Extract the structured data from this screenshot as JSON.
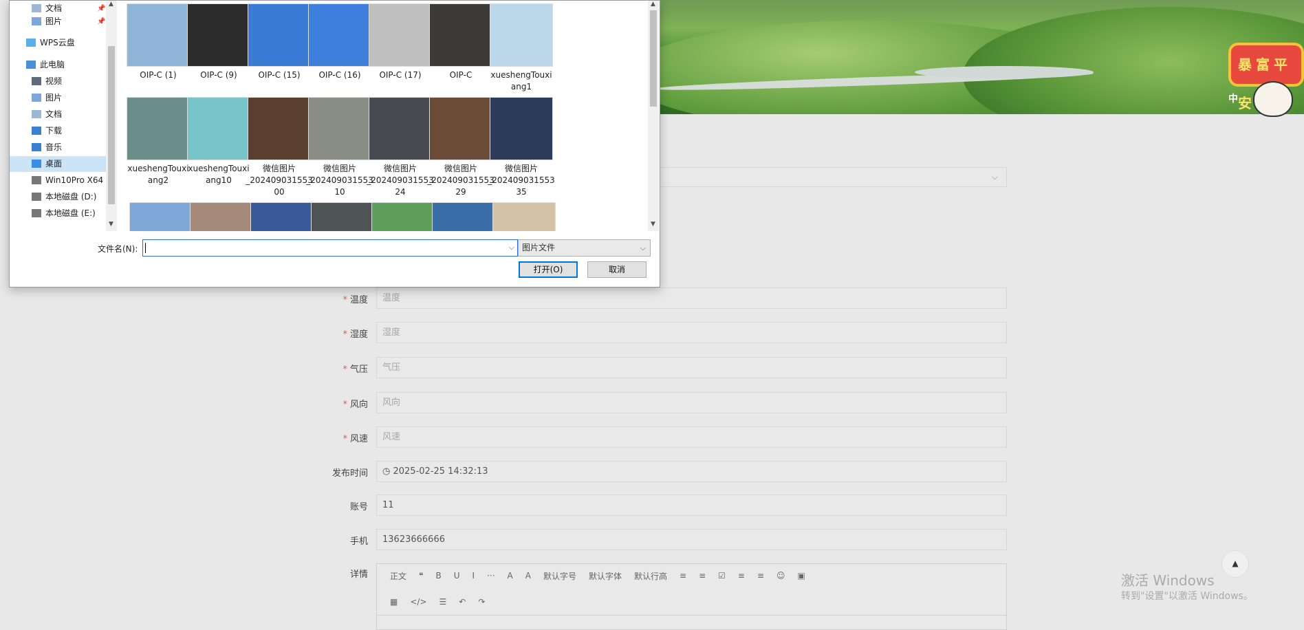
{
  "dialog": {
    "nav_items": [
      {
        "label": "文档",
        "icon": "document-icon",
        "pinned": true
      },
      {
        "label": "图片",
        "icon": "pictures-icon",
        "pinned": true
      },
      {
        "label": "WPS云盘",
        "icon": "cloud-icon",
        "pinned": false
      },
      {
        "label": "此电脑",
        "icon": "computer-icon",
        "pinned": false
      },
      {
        "label": "视频",
        "icon": "video-icon",
        "pinned": false
      },
      {
        "label": "图片",
        "icon": "pictures-icon",
        "pinned": false
      },
      {
        "label": "文档",
        "icon": "document-icon",
        "pinned": false
      },
      {
        "label": "下载",
        "icon": "download-icon",
        "pinned": false
      },
      {
        "label": "音乐",
        "icon": "music-icon",
        "pinned": false
      },
      {
        "label": "桌面",
        "icon": "desktop-icon",
        "pinned": false,
        "selected": true
      },
      {
        "label": "Win10Pro X64",
        "icon": "drive-icon",
        "pinned": false
      },
      {
        "label": "本地磁盘 (D:)",
        "icon": "drive-icon",
        "pinned": false
      },
      {
        "label": "本地磁盘 (E:)",
        "icon": "drive-icon",
        "pinned": false
      }
    ],
    "files_row1": [
      {
        "name": "OIP-C (1)",
        "color": "#8fb4d8"
      },
      {
        "name": "OIP-C (9)",
        "color": "#2b2b2b"
      },
      {
        "name": "OIP-C (15)",
        "color": "#3a7bd5"
      },
      {
        "name": "OIP-C (16)",
        "color": "#3f7fdc"
      },
      {
        "name": "OIP-C (17)",
        "color": "#bfbfbf"
      },
      {
        "name": "OIP-C",
        "color": "#3c3a36"
      },
      {
        "name": "xueshengTouxiang1",
        "color": "#bcd6ea"
      }
    ],
    "files_row2": [
      {
        "name": "xueshengTouxiang2",
        "color": "#6a8f8c"
      },
      {
        "name": "xueshengTouxiang10",
        "color": "#77c4c9"
      },
      {
        "name": "微信图片_2024090315530​0",
        "display": [
          "微信图片",
          "_202409031553",
          "00"
        ],
        "color": "#5a3f2e"
      },
      {
        "name": "微信图片_20240903155310",
        "display": [
          "微信图片",
          "_202409031553",
          "10"
        ],
        "color": "#8a8c86"
      },
      {
        "name": "微信图片_20240903155324",
        "display": [
          "微信图片",
          "_202409031553",
          "24"
        ],
        "color": "#4a4a52"
      },
      {
        "name": "微信图片_20240903155329",
        "display": [
          "微信图片",
          "_202409031553",
          "29"
        ],
        "color": "#6b4a37"
      },
      {
        "name": "微信图片_20240903155335",
        "display": [
          "微信图片",
          "_202409031553",
          "35"
        ],
        "color": "#2c3b5a"
      }
    ],
    "files_row3_colors": [
      "#7fa8d9",
      "#a58a7a",
      "#3a5a9a",
      "#4e5456",
      "#5d9e5a",
      "#3a6ea8",
      "#d4c2a8"
    ],
    "filename_label": "文件名(N):",
    "filename_value": "",
    "filetype_value": "图片文件",
    "open_label": "打开(O)",
    "cancel_label": "取消"
  },
  "form": {
    "fields": [
      {
        "label": "温度",
        "required": true,
        "value": "",
        "placeholder": "温度"
      },
      {
        "label": "湿度",
        "required": true,
        "value": "",
        "placeholder": "湿度"
      },
      {
        "label": "气压",
        "required": true,
        "value": "",
        "placeholder": "气压"
      },
      {
        "label": "风向",
        "required": true,
        "value": "",
        "placeholder": "风向"
      },
      {
        "label": "风速",
        "required": true,
        "value": "",
        "placeholder": "风速"
      },
      {
        "label": "发布时间",
        "required": false,
        "value": "2025-02-25 14:32:13",
        "placeholder": ""
      },
      {
        "label": "账号",
        "required": false,
        "value": "11",
        "placeholder": ""
      },
      {
        "label": "手机",
        "required": false,
        "value": "13623666666",
        "placeholder": ""
      }
    ],
    "detail_label": "详情",
    "editor_toolbar_row1": [
      "正文",
      "❝",
      "B",
      "U",
      "I",
      "···",
      "A",
      "A",
      "默认字号",
      "默认字体",
      "默认行高",
      "≡",
      "≡",
      "☑",
      "≡",
      "≡",
      "☺",
      "▣"
    ],
    "editor_toolbar_row2": [
      "▦",
      "</>",
      "☰",
      "↶",
      "↷"
    ]
  },
  "banner": {
    "sticker_text": "暴富平安",
    "sticker_sub": "中"
  },
  "watermark": {
    "line1": "激活 Windows",
    "line2": "转到\"设置\"以激活 Windows。"
  }
}
